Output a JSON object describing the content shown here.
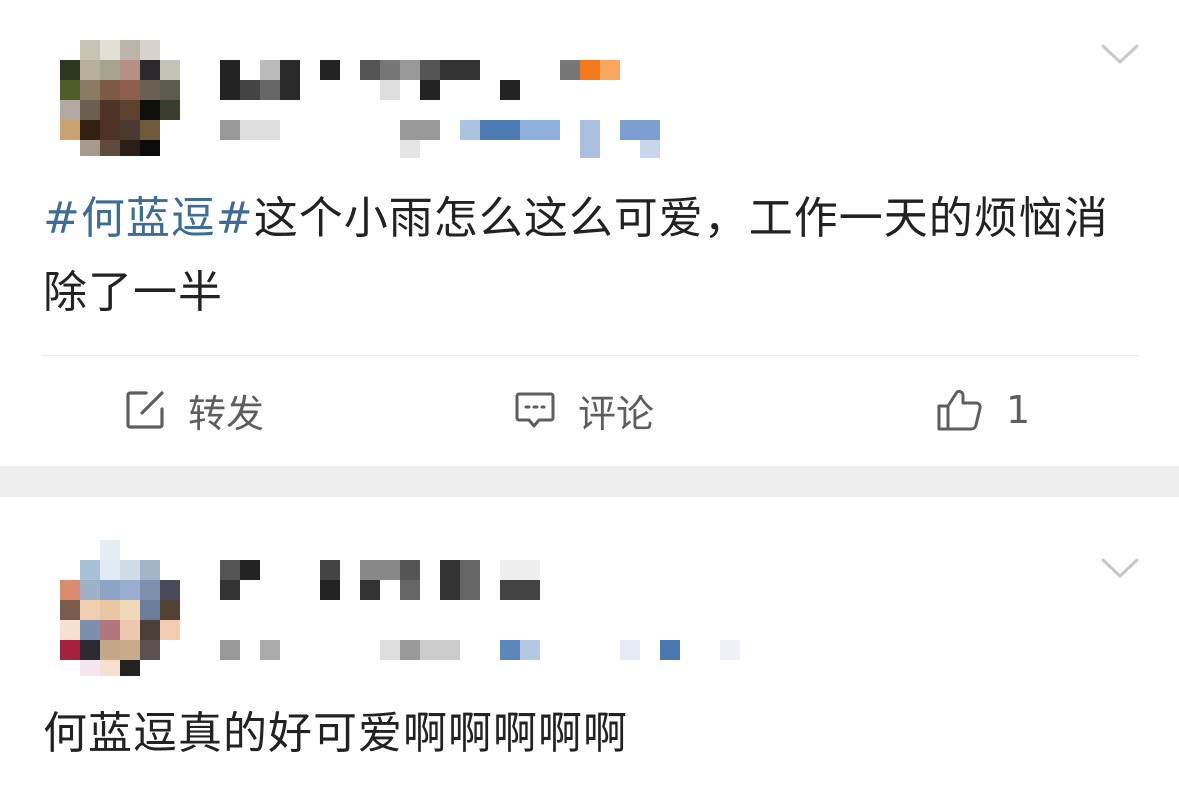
{
  "feed": {
    "posts": [
      {
        "author_avatar": "blurred-avatar",
        "author_name_hidden": true,
        "topic": "#何蓝逗#",
        "text": "这个小雨怎么这么可爱，工作一天的烦恼消除了一半",
        "actions": {
          "repost_label": "转发",
          "comment_label": "评论",
          "like_count": "1"
        },
        "icons": {
          "menu": "chevron-down-icon",
          "repost": "share-edit-icon",
          "comment": "comment-bubble-icon",
          "like": "thumbs-up-icon"
        }
      },
      {
        "author_avatar": "blurred-avatar",
        "author_name_hidden": true,
        "text": "何蓝逗真的好可爱啊啊啊啊啊",
        "icons": {
          "menu": "chevron-down-icon"
        }
      }
    ]
  },
  "colors": {
    "topic_link": "#3e6c97",
    "body_text": "#222222",
    "action_text": "#5e5e5e",
    "separator": "#eeeeee"
  }
}
